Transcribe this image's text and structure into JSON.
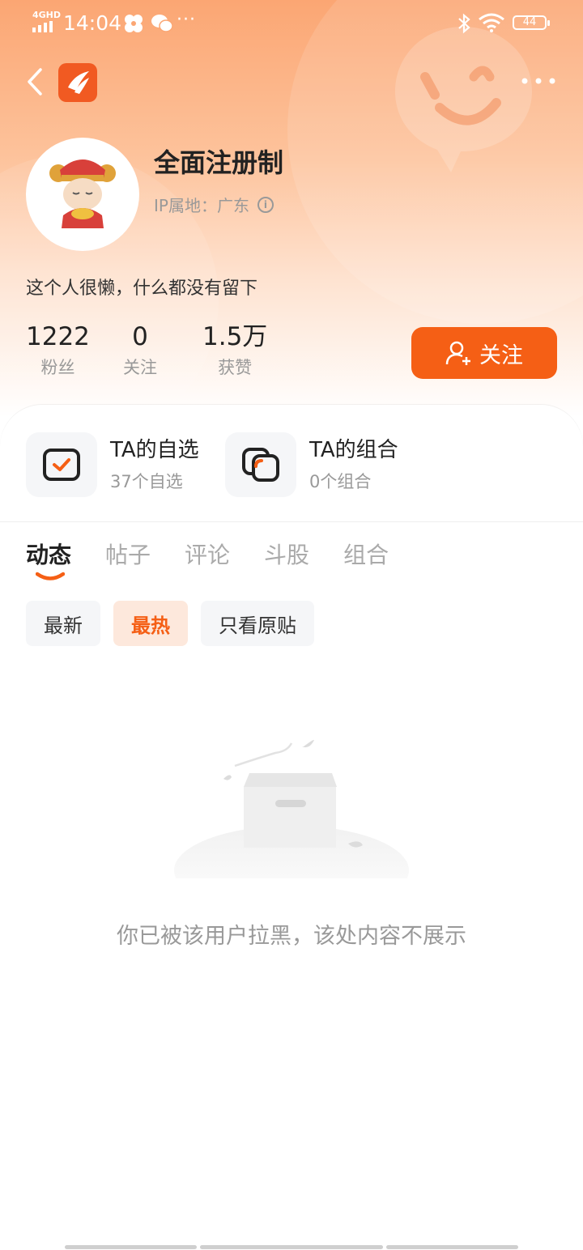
{
  "status_bar": {
    "network": "4GHD",
    "time": "14:04",
    "more": "···",
    "battery": "44"
  },
  "header": {
    "back_icon": "chevron-left-icon",
    "app_logo": "app-logo",
    "menu_icon": "more-dots-icon"
  },
  "profile": {
    "name": "全面注册制",
    "ip_location": "IP属地：广东",
    "bio": "这个人很懒，什么都没有留下",
    "stats": [
      {
        "value": "1222",
        "label": "粉丝"
      },
      {
        "value": "0",
        "label": "关注"
      },
      {
        "value": "1.5万",
        "label": "获赞"
      }
    ],
    "follow_label": "关注"
  },
  "entries": [
    {
      "title": "TA的自选",
      "subtitle": "37个自选",
      "icon": "checkbox-icon"
    },
    {
      "title": "TA的组合",
      "subtitle": "0个组合",
      "icon": "portfolio-icon"
    }
  ],
  "tabs": [
    "动态",
    "帖子",
    "评论",
    "斗股",
    "组合"
  ],
  "active_tab": "动态",
  "filters": [
    "最新",
    "最热",
    "只看原贴"
  ],
  "active_filter": "最热",
  "empty_message": "你已被该用户拉黑，该处内容不展示",
  "colors": {
    "accent": "#f55f15",
    "hero_top": "#fba673"
  }
}
